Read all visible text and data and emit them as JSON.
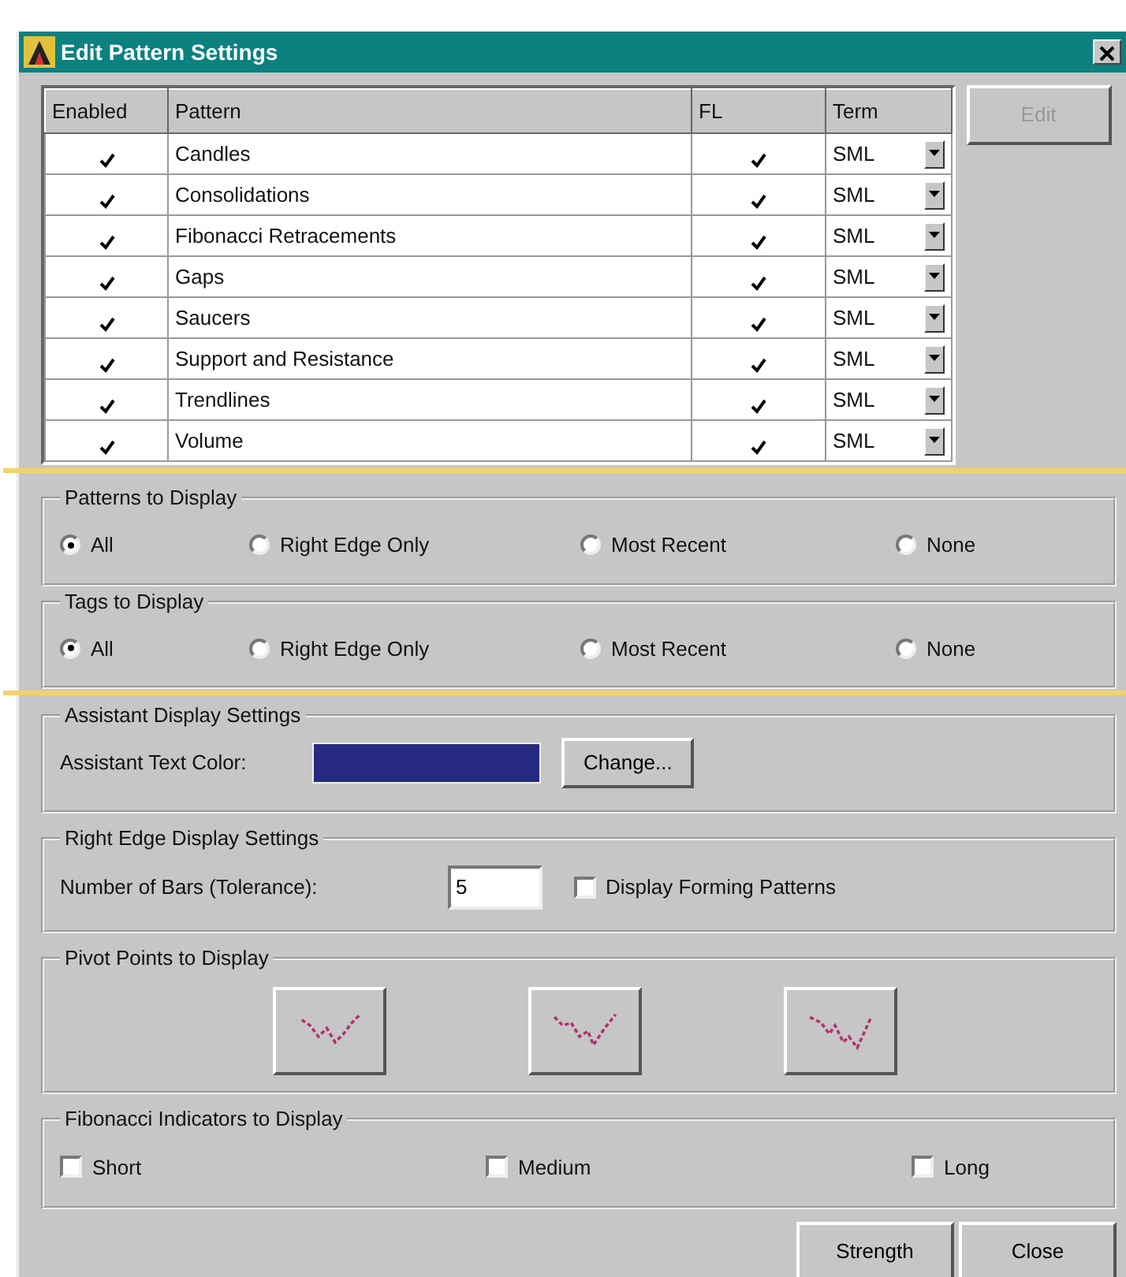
{
  "window": {
    "title": "Edit Pattern Settings"
  },
  "table": {
    "columns": [
      "Enabled",
      "Pattern",
      "FL",
      "Term"
    ],
    "rows": [
      {
        "enabled": true,
        "pattern": "Candles",
        "fl": true,
        "term": "SML"
      },
      {
        "enabled": true,
        "pattern": "Consolidations",
        "fl": true,
        "term": "SML"
      },
      {
        "enabled": true,
        "pattern": "Fibonacci Retracements",
        "fl": true,
        "term": "SML"
      },
      {
        "enabled": true,
        "pattern": "Gaps",
        "fl": true,
        "term": "SML"
      },
      {
        "enabled": true,
        "pattern": "Saucers",
        "fl": true,
        "term": "SML"
      },
      {
        "enabled": true,
        "pattern": "Support and Resistance",
        "fl": true,
        "term": "SML"
      },
      {
        "enabled": true,
        "pattern": "Trendlines",
        "fl": true,
        "term": "SML"
      },
      {
        "enabled": true,
        "pattern": "Volume",
        "fl": true,
        "term": "SML"
      }
    ]
  },
  "edit_button": {
    "label": "Edit",
    "disabled": true
  },
  "patterns_to_display": {
    "title": "Patterns to Display",
    "options": [
      {
        "label": "All",
        "selected": true
      },
      {
        "label": "Right Edge Only",
        "selected": false
      },
      {
        "label": "Most Recent",
        "selected": false
      },
      {
        "label": "None",
        "selected": false
      }
    ]
  },
  "tags_to_display": {
    "title": "Tags to Display",
    "options": [
      {
        "label": "All",
        "selected": true
      },
      {
        "label": "Right Edge Only",
        "selected": false
      },
      {
        "label": "Most Recent",
        "selected": false
      },
      {
        "label": "None",
        "selected": false
      }
    ]
  },
  "assistant_display_settings": {
    "title": "Assistant Display Settings",
    "label": "Assistant Text Color:",
    "color": "#262a80",
    "button": "Change..."
  },
  "right_edge_display_settings": {
    "title": "Right Edge Display Settings",
    "label": "Number of Bars (Tolerance):",
    "value": "5",
    "checkbox": {
      "label": "Display Forming Patterns",
      "checked": false
    }
  },
  "pivot_points_to_display": {
    "title": "Pivot Points to Display",
    "buttons": [
      {
        "kind": "short"
      },
      {
        "kind": "medium"
      },
      {
        "kind": "long"
      }
    ]
  },
  "fibonacci_indicators_to_display": {
    "title": "Fibonacci Indicators to Display",
    "options": [
      {
        "label": "Short",
        "checked": false
      },
      {
        "label": "Medium",
        "checked": false
      },
      {
        "label": "Long",
        "checked": false
      }
    ]
  },
  "buttons": [
    "Strength",
    "Close"
  ]
}
